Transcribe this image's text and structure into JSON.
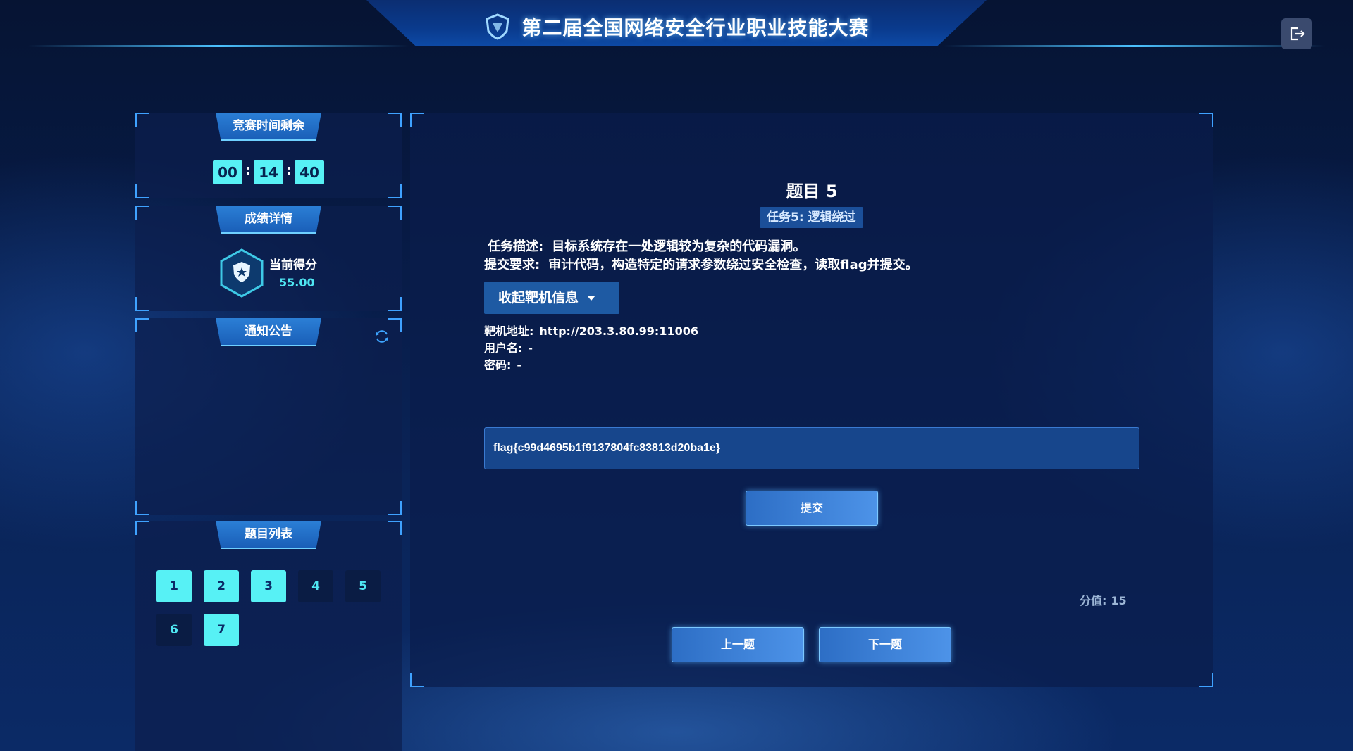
{
  "header": {
    "title": "第二届全国网络安全行业职业技能大赛",
    "logo_icon": "shield-logo-icon",
    "logout_icon": "logout-icon"
  },
  "timer_panel": {
    "title": "竞赛时间剩余",
    "hours": "00",
    "minutes": "14",
    "seconds": "40",
    "separator": ":"
  },
  "score_panel": {
    "title": "成绩详情",
    "label": "当前得分",
    "value": "55.00",
    "icon": "shield-star-icon"
  },
  "notice_panel": {
    "title": "通知公告",
    "refresh_icon": "refresh-icon"
  },
  "question_list": {
    "title": "题目列表",
    "items": [
      {
        "label": "1",
        "status": "done"
      },
      {
        "label": "2",
        "status": "done"
      },
      {
        "label": "3",
        "status": "done"
      },
      {
        "label": "4",
        "status": "todo"
      },
      {
        "label": "5",
        "status": "todo"
      },
      {
        "label": "6",
        "status": "todo"
      },
      {
        "label": "7",
        "status": "done"
      }
    ]
  },
  "question": {
    "title": "题目 5",
    "task_tag": "任务5: 逻辑绕过",
    "desc_key": "任务描述:",
    "desc_value": "目标系统存在一处逻辑较为复杂的代码漏洞。",
    "req_key": "提交要求:",
    "req_value": "审计代码，构造特定的请求参数绕过安全检查，读取flag并提交。",
    "collapse_label": "收起靶机信息",
    "target_key": "靶机地址:",
    "target_value": "http://203.3.80.99:11006",
    "username_key": "用户名:",
    "username_value": "-",
    "password_key": "密码:",
    "password_value": "-",
    "flag_value": "flag{c99d4695b1f9137804fc83813d20ba1e}",
    "submit_label": "提交",
    "points_key": "分值:",
    "points_value": "15",
    "prev_label": "上一题",
    "next_label": "下一题"
  },
  "colors": {
    "accent_cyan": "#57f1f5",
    "panel_bg": "#0c1e4e",
    "button_blue": "#2d6ec5"
  }
}
